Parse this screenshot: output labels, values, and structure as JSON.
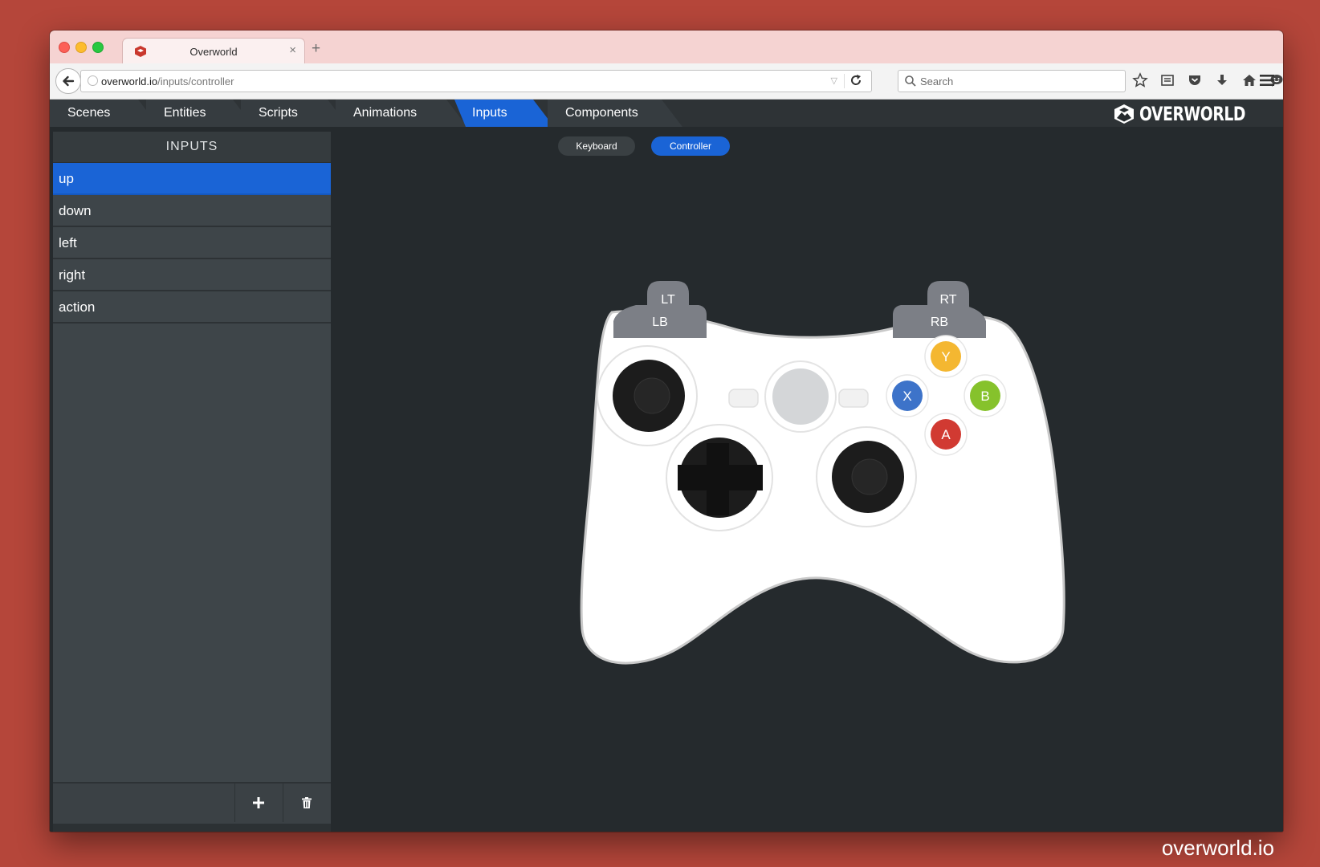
{
  "browser": {
    "tab_title": "Overworld",
    "url_host": "overworld.io",
    "url_path": "/inputs/controller",
    "search_placeholder": "Search"
  },
  "app": {
    "tabs": [
      {
        "label": "Scenes",
        "active": false
      },
      {
        "label": "Entities",
        "active": false
      },
      {
        "label": "Scripts",
        "active": false
      },
      {
        "label": "Animations",
        "active": false
      },
      {
        "label": "Inputs",
        "active": true
      },
      {
        "label": "Components",
        "active": false
      }
    ],
    "logo_text": "OVERWORLD",
    "accent_color": "#1a64d6"
  },
  "sidebar": {
    "header": "INPUTS",
    "inputs": [
      {
        "label": "up",
        "selected": true
      },
      {
        "label": "down",
        "selected": false
      },
      {
        "label": "left",
        "selected": false
      },
      {
        "label": "right",
        "selected": false
      },
      {
        "label": "action",
        "selected": false
      }
    ],
    "add_icon": "plus-icon",
    "delete_icon": "trash-icon"
  },
  "mode_toggle": {
    "keyboard": "Keyboard",
    "controller": "Controller",
    "selected": "Controller"
  },
  "controller": {
    "lt": "LT",
    "rt": "RT",
    "lb": "LB",
    "rb": "RB",
    "y": "Y",
    "x": "X",
    "b": "B",
    "a": "A",
    "colors": {
      "y": "#f4b731",
      "x": "#3d73c9",
      "b": "#86c22c",
      "a": "#d13a32"
    }
  },
  "watermark": "overworld.io"
}
